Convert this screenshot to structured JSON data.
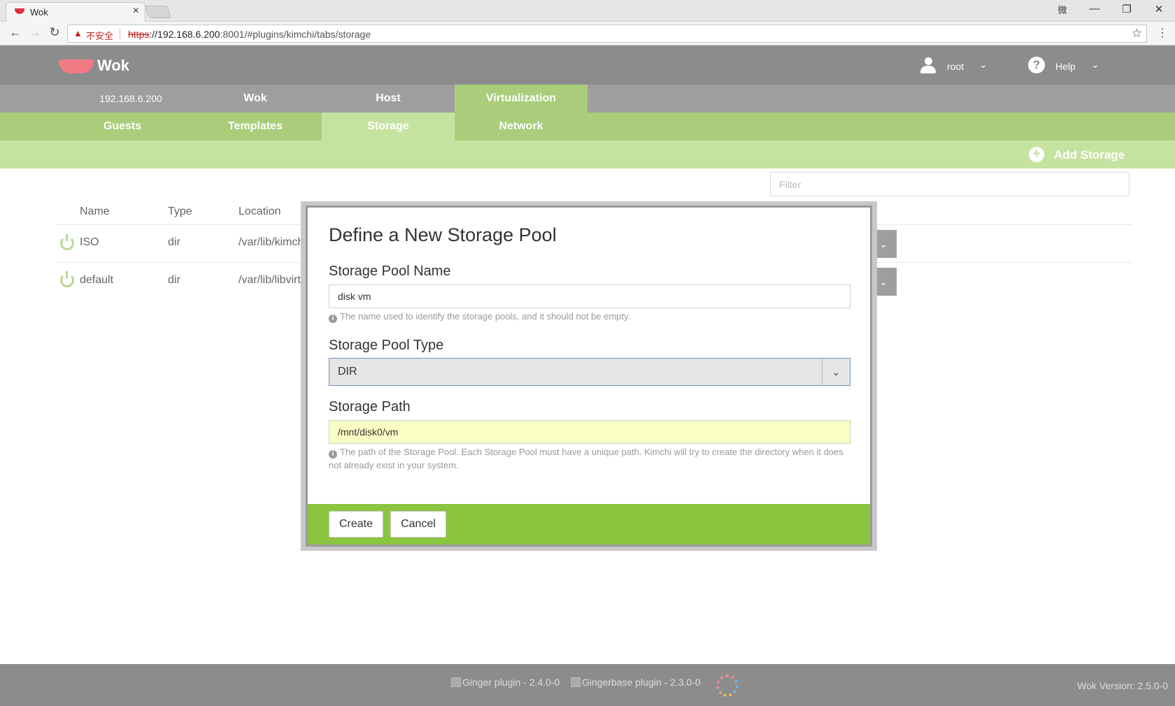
{
  "browser": {
    "tab_title": "Wok",
    "security_label": "不安全",
    "url_scheme": "https",
    "url_host": "://192.168.6.200",
    "url_rest": ":8001/#plugins/kimchi/tabs/storage",
    "ime_indicator": "微"
  },
  "header": {
    "logo_text": "Wok",
    "user_name": "root",
    "help_label": "Help"
  },
  "topnav": {
    "items": [
      "192.168.6.200",
      "Wok",
      "Host",
      "Virtualization"
    ],
    "active": "Virtualization"
  },
  "subnav": {
    "items": [
      "Guests",
      "Templates",
      "Storage",
      "Network"
    ],
    "active": "Storage"
  },
  "actionbar": {
    "add_label": "Add Storage"
  },
  "filter": {
    "placeholder": "Filter"
  },
  "table": {
    "columns": [
      "Name",
      "Type",
      "Location"
    ],
    "rows": [
      {
        "name": "ISO",
        "type": "dir",
        "location": "/var/lib/kimch"
      },
      {
        "name": "default",
        "type": "dir",
        "location": "/var/lib/libvirt/"
      }
    ]
  },
  "modal": {
    "title": "Define a New Storage Pool",
    "name_label": "Storage Pool Name",
    "name_value": "disk vm",
    "name_help": "The name used to identify the storage pools, and it should not be empty.",
    "type_label": "Storage Pool Type",
    "type_value": "DIR",
    "path_label": "Storage Path",
    "path_value": "/mnt/disk0/vm",
    "path_help": "The path of the Storage Pool. Each Storage Pool must have a unique path. Kimchi will try to create the directory when it does not already exist in your system.",
    "create_label": "Create",
    "cancel_label": "Cancel"
  },
  "footer": {
    "ginger_alt": "Ginger plugin - 2.4.0-0",
    "gingerbase_alt": "Gingerbase plugin - 2.3.0-0",
    "version": "Wok Version: 2.5.0-0"
  },
  "colors": {
    "header": "#8c8c8c",
    "nav_green": "#a9cd7a",
    "light_green": "#c5e3a0",
    "footer_green": "#8bc53f",
    "logo_pink": "#f27a84"
  }
}
